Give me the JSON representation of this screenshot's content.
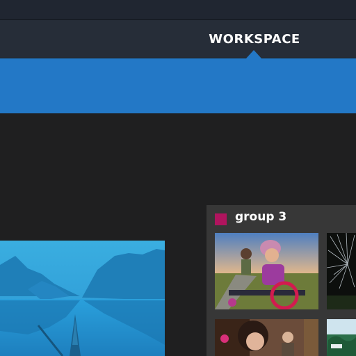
{
  "nav": {
    "active_tab": "WORKSPACE"
  },
  "colors": {
    "accent": "#2378c6",
    "group_color": "#b0145e",
    "background": "#1f1f20",
    "panel": "#373737"
  },
  "group": {
    "title": "group 3",
    "thumbnails": [
      {
        "name": "cyclist-photo"
      },
      {
        "name": "firework-photo"
      },
      {
        "name": "crowd-photo"
      },
      {
        "name": "boats-photo"
      }
    ]
  },
  "preview": {
    "name": "mountain-lake-kayak-photo"
  }
}
